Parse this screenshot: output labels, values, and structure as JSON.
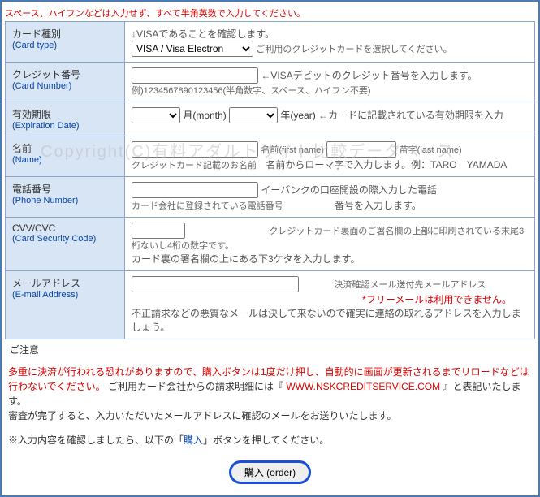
{
  "top_warning": "スペース、ハイフンなどは入力せず、すべて半角英数で入力してください。",
  "watermark": "Copyright(C)有料アダルトサイト比較データベース",
  "rows": {
    "card_type": {
      "jp": "カード種別",
      "en": "(Card type)",
      "select_value": "VISA / Visa Electron",
      "anno_top": "↓VISAであることを確認します。",
      "anno_right": "ご利用のクレジットカードを選択してください。"
    },
    "card_number": {
      "jp": "クレジット番号",
      "en": "(Card Number)",
      "anno": "←VISAデビットのクレジット番号を入力します。",
      "hint": "例)1234567890123456(半角数字、スペース、ハイフン不要)"
    },
    "exp": {
      "jp": "有効期限",
      "en": "(Expiration Date)",
      "month": "月(month)",
      "year": "年(year)",
      "anno": "←カードに記載されている有効期限を入力"
    },
    "name": {
      "jp": "名前",
      "en": "(Name)",
      "hint": "クレジットカード記載のお名前",
      "first": "名前(first name)",
      "last": "苗字(last name)",
      "anno": "名前からローマ字で入力します。例：TARO　YAMADA"
    },
    "phone": {
      "jp": "電話番号",
      "en": "(Phone Number)",
      "hint": "カード会社に登録されている電話番号",
      "anno1": "イーバンクの口座開設の際入力した電話",
      "anno2": "番号を入力します。"
    },
    "cvv": {
      "jp": "CVV/CVC",
      "en": "(Card Security Code)",
      "hint": "カード裏の署名欄の上にある下3ケタを入力します。",
      "hint_right": "クレジットカード裏面のご署名欄の上部に印刷されている末尾3桁ないし4桁の数字です。"
    },
    "email": {
      "jp": "メールアドレス",
      "en": "(E-mail Address)",
      "hint_right": "決済確認メール送付先メールアドレス",
      "warn": "*フリーメールは利用できません。",
      "anno": "不正請求などの悪質なメールは決して来ないので確実に連絡の取れるアドレスを入力しましょう。"
    }
  },
  "notice_label": "ご注意",
  "notice_red1": "多重に決済が行われる恐れがありますので、購入ボタンは1度だけ押し、自動的に画面が更新されるまでリロードなどは行わないでください。",
  "notice_line2a": "ご利用カード会社からの請求明細には『 ",
  "notice_url": "WWW.NSKCREDITSERVICE.COM",
  "notice_line2b": " 』と表記いたします。",
  "notice_line3": "審査が完了すると、入力いただいたメールアドレスに確認のメールをお送りいたします。",
  "confirm_a": "※入力内容を確認しましたら、以下の「",
  "confirm_link": "購入",
  "confirm_b": "」ボタンを押してください。",
  "order_btn": "購入 (order)"
}
